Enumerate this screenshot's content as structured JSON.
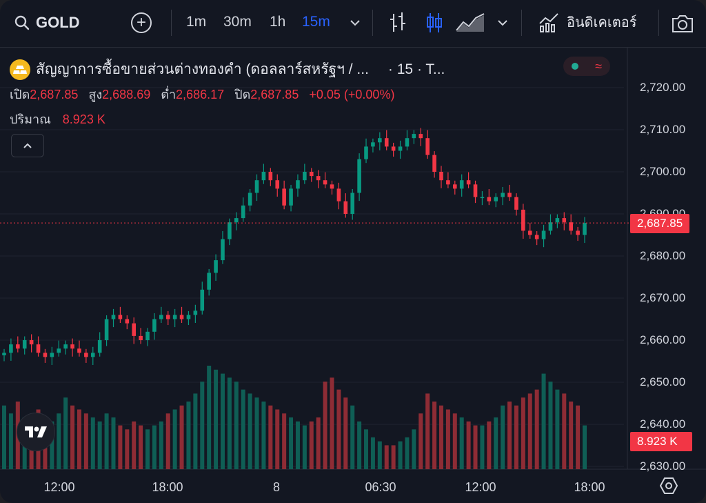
{
  "toolbar": {
    "symbol": "GOLD",
    "intervals": [
      "1m",
      "30m",
      "1h",
      "15m"
    ],
    "active_interval": "15m",
    "indicators_label": "อินดิเคเตอร์"
  },
  "legend": {
    "title": "สัญญาการซื้อขายส่วนต่างทองคำ (ดอลลาร์สหรัฐฯ / ...",
    "suffix": "· 15 · T...",
    "open_label": "เปิด",
    "open": "2,687.85",
    "high_label": "สูง",
    "high": "2,688.69",
    "low_label": "ต่ำ",
    "low": "2,686.17",
    "close_label": "ปิด",
    "close": "2,687.85",
    "change": "+0.05 (+0.00%)",
    "volume_label": "ปริมาณ",
    "volume": "8.923 K"
  },
  "price_axis": [
    "2,720.00",
    "2,710.00",
    "2,700.00",
    "2,690.00",
    "2,680.00",
    "2,670.00",
    "2,660.00",
    "2,650.00",
    "2,640.00",
    "2,630.00"
  ],
  "price_tag": "2,687.85",
  "volume_tag": "8.923 K",
  "time_axis": [
    "12:00",
    "18:00",
    "8",
    "06:30",
    "12:00",
    "18:00"
  ],
  "colors": {
    "up": "#089981",
    "down": "#f23645",
    "background": "#131722",
    "accent": "#2962ff"
  },
  "chart_data": {
    "type": "candlestick",
    "last_price": 2687.85,
    "y_range": [
      2630,
      2722
    ],
    "close": [
      2657,
      2659,
      2658,
      2660,
      2659,
      2657,
      2656,
      2657,
      2658,
      2659,
      2658,
      2657,
      2656,
      2657,
      2660,
      2665,
      2666,
      2665,
      2664,
      2661,
      2660,
      2662,
      2665,
      2666,
      2665,
      2666,
      2665,
      2666,
      2667,
      2672,
      2676,
      2679,
      2684,
      2688,
      2689,
      2692,
      2695,
      2698,
      2700,
      2698,
      2696,
      2692,
      2696,
      2698,
      2700,
      2699,
      2698,
      2697,
      2696,
      2693,
      2690,
      2695,
      2703,
      2706,
      2707,
      2708,
      2706,
      2705,
      2706,
      2708,
      2709,
      2708,
      2704,
      2700,
      2698,
      2697,
      2696,
      2698,
      2697,
      2694,
      2694,
      2693,
      2694,
      2695,
      2694,
      2691,
      2686,
      2685,
      2684,
      2686,
      2688,
      2689,
      2688,
      2686,
      2685,
      2687.85
    ],
    "volume": [
      80,
      70,
      85,
      65,
      60,
      75,
      55,
      60,
      70,
      90,
      80,
      75,
      70,
      65,
      60,
      70,
      65,
      55,
      50,
      60,
      55,
      50,
      55,
      60,
      70,
      75,
      80,
      85,
      95,
      110,
      130,
      125,
      120,
      115,
      110,
      100,
      95,
      90,
      85,
      80,
      75,
      70,
      65,
      60,
      55,
      60,
      65,
      110,
      115,
      100,
      90,
      80,
      60,
      50,
      40,
      35,
      30,
      30,
      35,
      40,
      50,
      70,
      95,
      85,
      80,
      75,
      70,
      65,
      60,
      55,
      55,
      60,
      65,
      80,
      85,
      80,
      90,
      95,
      100,
      120,
      110,
      100,
      95,
      85,
      80,
      55
    ]
  }
}
